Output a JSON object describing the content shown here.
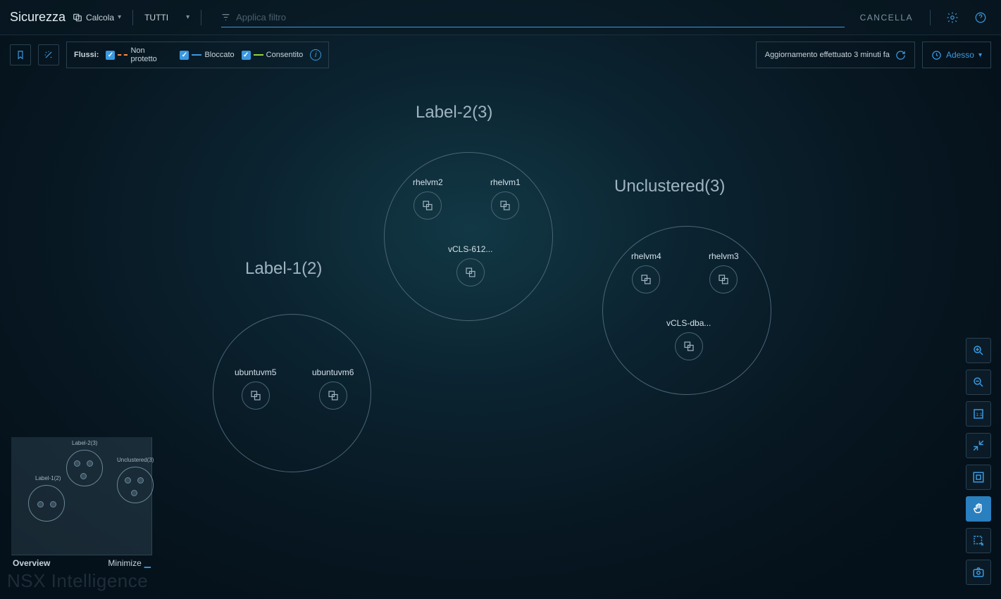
{
  "header": {
    "title": "Sicurezza",
    "compute_dd": "Calcola",
    "scope_dd": "TUTTI",
    "filter_placeholder": "Applica filtro",
    "cancel": "CANCELLA"
  },
  "flows": {
    "label": "Flussi:",
    "unprotected": "Non protetto",
    "blocked": "Bloccato",
    "allowed": "Consentito"
  },
  "refresh": {
    "text": "Aggiornamento effettuato 3 minuti fa",
    "now": "Adesso"
  },
  "clusters": {
    "label1": {
      "title": "Label-1(2)",
      "vms": [
        "ubuntuvm5",
        "ubuntuvm6"
      ]
    },
    "label2": {
      "title": "Label-2(3)",
      "vms": [
        "rhelvm2",
        "rhelvm1",
        "vCLS-612..."
      ]
    },
    "unclustered": {
      "title": "Unclustered(3)",
      "vms": [
        "rhelvm4",
        "rhelvm3",
        "vCLS-dba..."
      ]
    }
  },
  "overview": {
    "title": "Overview",
    "minimize": "Minimize",
    "mini_labels": {
      "l1": "Label-1(2)",
      "l2": "Label-2(3)",
      "u": "Unclustered(3)"
    }
  },
  "brand": "NSX Intelligence"
}
